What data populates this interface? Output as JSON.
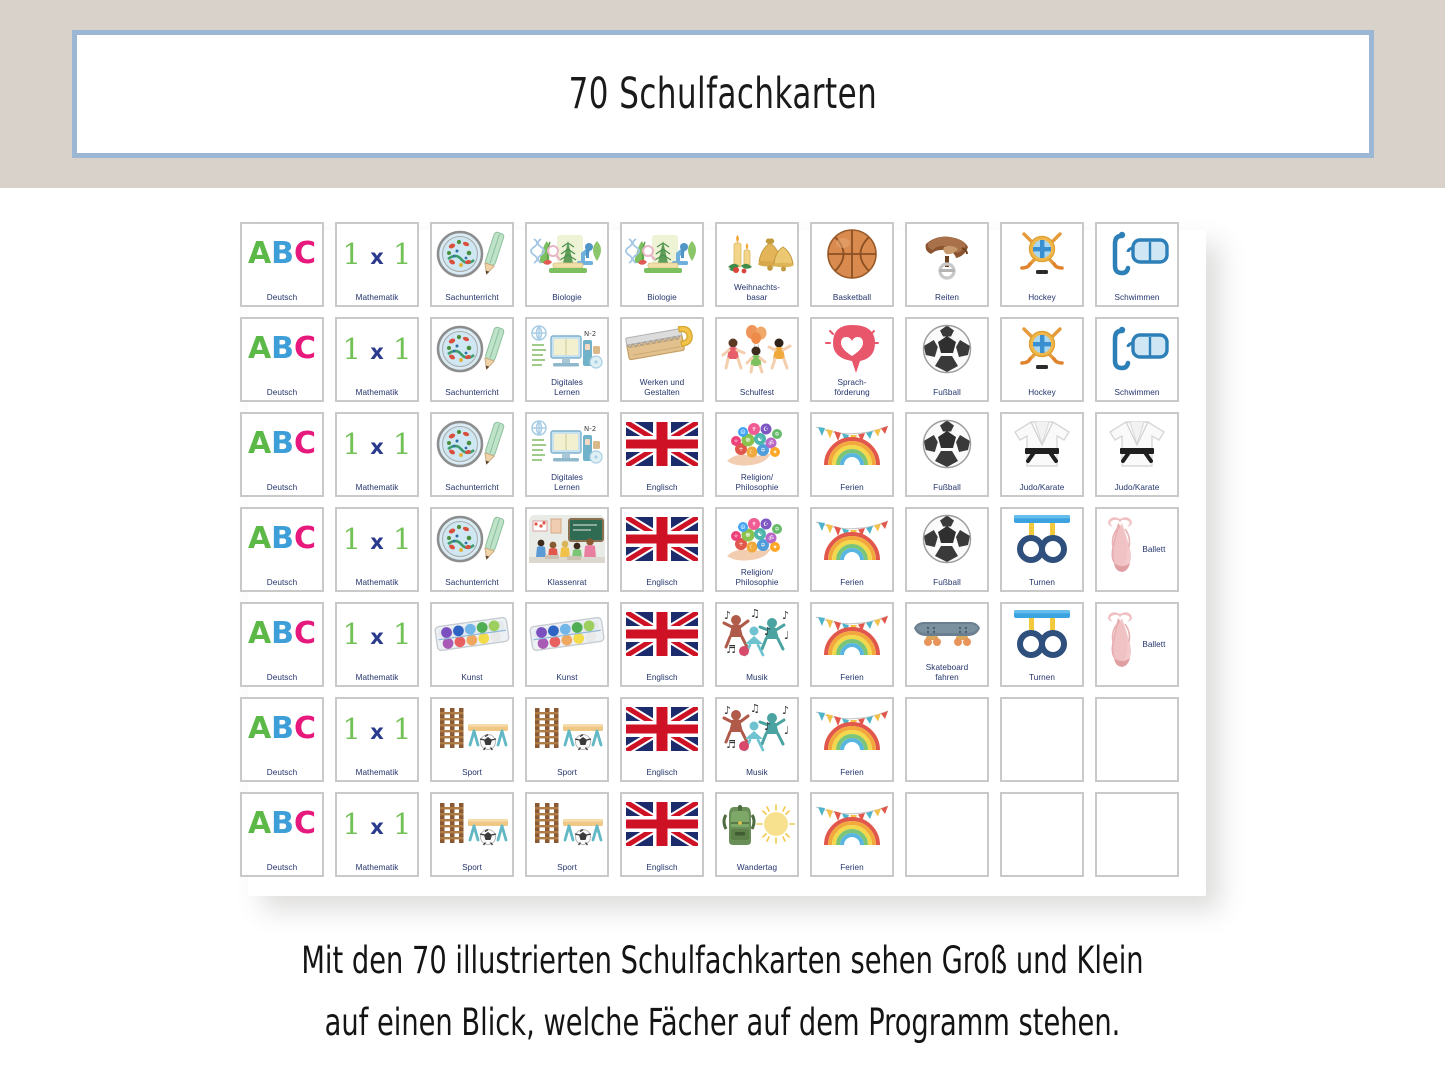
{
  "header": {
    "title": "70 Schulfachkarten",
    "band_color": "#d9d2cb",
    "border_color": "#9bb7d4"
  },
  "caption": {
    "line1": "Mit den 70 illustrierten Schulfachkarten sehen Groß und Klein",
    "line2": "auf einen Blick, welche Fächer auf dem Programm stehen."
  },
  "colors": {
    "label_navy": "#23346b",
    "card_border": "#c9c9c9",
    "abc_a": "#5cb947",
    "abc_b": "#3e9ed8",
    "abc_c": "#e8197d",
    "math_digit": "#72c156",
    "math_x": "#2a3a8c"
  },
  "grid": {
    "columns": 10,
    "rows": 7,
    "total_cards": 70,
    "cards": [
      {
        "label": "Deutsch",
        "icon": "abc-letters-icon"
      },
      {
        "label": "Mathematik",
        "icon": "one-times-one-icon"
      },
      {
        "label": "Sachunterricht",
        "icon": "petri-dish-pencil-icon"
      },
      {
        "label": "Biologie",
        "icon": "biology-microscope-plants-icon"
      },
      {
        "label": "Biologie",
        "icon": "biology-microscope-plants-icon"
      },
      {
        "label": "Weihnachts-\nbasar",
        "icon": "candles-bells-icon"
      },
      {
        "label": "Basketball",
        "icon": "basketball-icon"
      },
      {
        "label": "Reiten",
        "icon": "horse-saddle-icon"
      },
      {
        "label": "Hockey",
        "icon": "hockey-sticks-icon"
      },
      {
        "label": "Schwimmen",
        "icon": "diving-mask-snorkel-icon"
      },
      {
        "label": "Deutsch",
        "icon": "abc-letters-icon"
      },
      {
        "label": "Mathematik",
        "icon": "one-times-one-icon"
      },
      {
        "label": "Sachunterricht",
        "icon": "petri-dish-pencil-icon"
      },
      {
        "label": "Digitales\nLernen",
        "icon": "computer-desk-icon"
      },
      {
        "label": "Werken und\nGestalten",
        "icon": "saw-wood-icon"
      },
      {
        "label": "Schulfest",
        "icon": "children-balloons-icon"
      },
      {
        "label": "Sprach-\nförderung",
        "icon": "speech-bubble-heart-icon"
      },
      {
        "label": "Fußball",
        "icon": "soccer-ball-icon"
      },
      {
        "label": "Hockey",
        "icon": "hockey-sticks-icon"
      },
      {
        "label": "Schwimmen",
        "icon": "diving-mask-snorkel-icon"
      },
      {
        "label": "Deutsch",
        "icon": "abc-letters-icon"
      },
      {
        "label": "Mathematik",
        "icon": "one-times-one-icon"
      },
      {
        "label": "Sachunterricht",
        "icon": "petri-dish-pencil-icon"
      },
      {
        "label": "Digitales\nLernen",
        "icon": "computer-desk-icon"
      },
      {
        "label": "Englisch",
        "icon": "union-jack-flag-icon"
      },
      {
        "label": "Religion/\nPhilosophie",
        "icon": "hand-symbols-icon"
      },
      {
        "label": "Ferien",
        "icon": "rainbow-bunting-icon"
      },
      {
        "label": "Fußball",
        "icon": "soccer-ball-icon"
      },
      {
        "label": "Judo/Karate",
        "icon": "judo-gi-icon"
      },
      {
        "label": "Judo/Karate",
        "icon": "judo-gi-icon"
      },
      {
        "label": "Deutsch",
        "icon": "abc-letters-icon"
      },
      {
        "label": "Mathematik",
        "icon": "one-times-one-icon"
      },
      {
        "label": "Sachunterricht",
        "icon": "petri-dish-pencil-icon"
      },
      {
        "label": "Klassenrat",
        "icon": "classroom-icon"
      },
      {
        "label": "Englisch",
        "icon": "union-jack-flag-icon"
      },
      {
        "label": "Religion/\nPhilosophie",
        "icon": "hand-symbols-icon"
      },
      {
        "label": "Ferien",
        "icon": "rainbow-bunting-icon"
      },
      {
        "label": "Fußball",
        "icon": "soccer-ball-icon"
      },
      {
        "label": "Turnen",
        "icon": "gymnastic-rings-icon"
      },
      {
        "label": "Ballett",
        "icon": "ballet-shoes-icon",
        "side": true
      },
      {
        "label": "Deutsch",
        "icon": "abc-letters-icon"
      },
      {
        "label": "Mathematik",
        "icon": "one-times-one-icon"
      },
      {
        "label": "Kunst",
        "icon": "paint-palette-icon"
      },
      {
        "label": "Kunst",
        "icon": "paint-palette-icon"
      },
      {
        "label": "Englisch",
        "icon": "union-jack-flag-icon"
      },
      {
        "label": "Musik",
        "icon": "dancing-musicians-icon"
      },
      {
        "label": "Ferien",
        "icon": "rainbow-bunting-icon"
      },
      {
        "label": "Skateboard\nfahren",
        "icon": "skateboard-icon"
      },
      {
        "label": "Turnen",
        "icon": "gymnastic-rings-icon"
      },
      {
        "label": "Ballett",
        "icon": "ballet-shoes-icon",
        "side": true
      },
      {
        "label": "Deutsch",
        "icon": "abc-letters-icon"
      },
      {
        "label": "Mathematik",
        "icon": "one-times-one-icon"
      },
      {
        "label": "Sport",
        "icon": "gym-equipment-icon"
      },
      {
        "label": "Sport",
        "icon": "gym-equipment-icon"
      },
      {
        "label": "Englisch",
        "icon": "union-jack-flag-icon"
      },
      {
        "label": "Musik",
        "icon": "dancing-musicians-icon"
      },
      {
        "label": "Ferien",
        "icon": "rainbow-bunting-icon"
      },
      {
        "label": "",
        "icon": "blank"
      },
      {
        "label": "",
        "icon": "blank"
      },
      {
        "label": "",
        "icon": "blank"
      },
      {
        "label": "Deutsch",
        "icon": "abc-letters-icon"
      },
      {
        "label": "Mathematik",
        "icon": "one-times-one-icon"
      },
      {
        "label": "Sport",
        "icon": "gym-equipment-icon"
      },
      {
        "label": "Sport",
        "icon": "gym-equipment-icon"
      },
      {
        "label": "Englisch",
        "icon": "union-jack-flag-icon"
      },
      {
        "label": "Wandertag",
        "icon": "backpack-sun-icon"
      },
      {
        "label": "Ferien",
        "icon": "rainbow-bunting-icon"
      },
      {
        "label": "",
        "icon": "blank"
      },
      {
        "label": "",
        "icon": "blank"
      },
      {
        "label": "",
        "icon": "blank"
      }
    ]
  }
}
